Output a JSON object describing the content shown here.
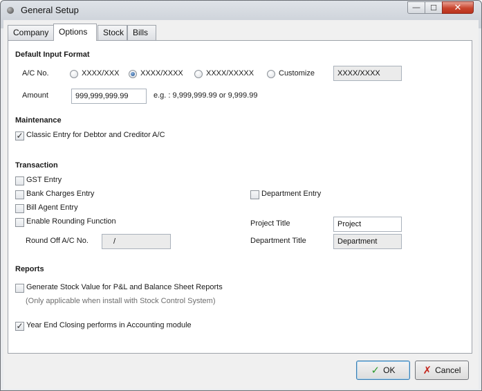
{
  "window": {
    "title": "General Setup",
    "minimize_glyph": "—",
    "maximize_glyph": "☐",
    "close_glyph": "✕"
  },
  "tabs": [
    {
      "label": "Company",
      "active": false
    },
    {
      "label": "Options",
      "active": true
    },
    {
      "label": "Stock",
      "active": false
    },
    {
      "label": "Bills",
      "active": false
    }
  ],
  "default_input_format": {
    "heading": "Default Input Format",
    "acno_label": "A/C No.",
    "acno_options": [
      {
        "label": "XXXX/XXX",
        "selected": false
      },
      {
        "label": "XXXX/XXXX",
        "selected": true
      },
      {
        "label": "XXXX/XXXXX",
        "selected": false
      },
      {
        "label": "Customize",
        "selected": false
      }
    ],
    "customize_value": "XXXX/XXXX",
    "amount_label": "Amount",
    "amount_value": "999,999,999.99",
    "amount_example": "e.g. : 9,999,999.99 or 9,999.99"
  },
  "maintenance": {
    "heading": "Maintenance",
    "classic_entry_label": "Classic Entry for Debtor and Creditor A/C",
    "classic_entry_checked": true
  },
  "transaction": {
    "heading": "Transaction",
    "gst_entry_label": "GST Entry",
    "gst_entry_checked": false,
    "bank_charges_label": "Bank Charges Entry",
    "bank_charges_checked": false,
    "bill_agent_label": "Bill Agent Entry",
    "bill_agent_checked": false,
    "rounding_label": "Enable Rounding Function",
    "rounding_checked": false,
    "round_off_label": "Round Off A/C No.",
    "round_off_value": "/",
    "department_entry_label": "Department Entry",
    "department_entry_checked": false,
    "project_title_label": "Project Title",
    "project_title_value": "Project",
    "department_title_label": "Department Title",
    "department_title_value": "Department"
  },
  "reports": {
    "heading": "Reports",
    "stock_value_label": "Generate Stock Value for P&L and Balance Sheet Reports",
    "stock_value_checked": false,
    "stock_value_note": "(Only applicable when install with Stock Control System)",
    "year_end_label": "Year End Closing performs in Accounting module",
    "year_end_checked": true
  },
  "buttons": {
    "ok_label": "OK",
    "ok_icon": "check-icon",
    "cancel_label": "Cancel",
    "cancel_icon": "x-icon"
  },
  "colors": {
    "ok_icon": "#2e9b2e",
    "cancel_icon": "#c4261d",
    "close_button": "#c9452e"
  }
}
